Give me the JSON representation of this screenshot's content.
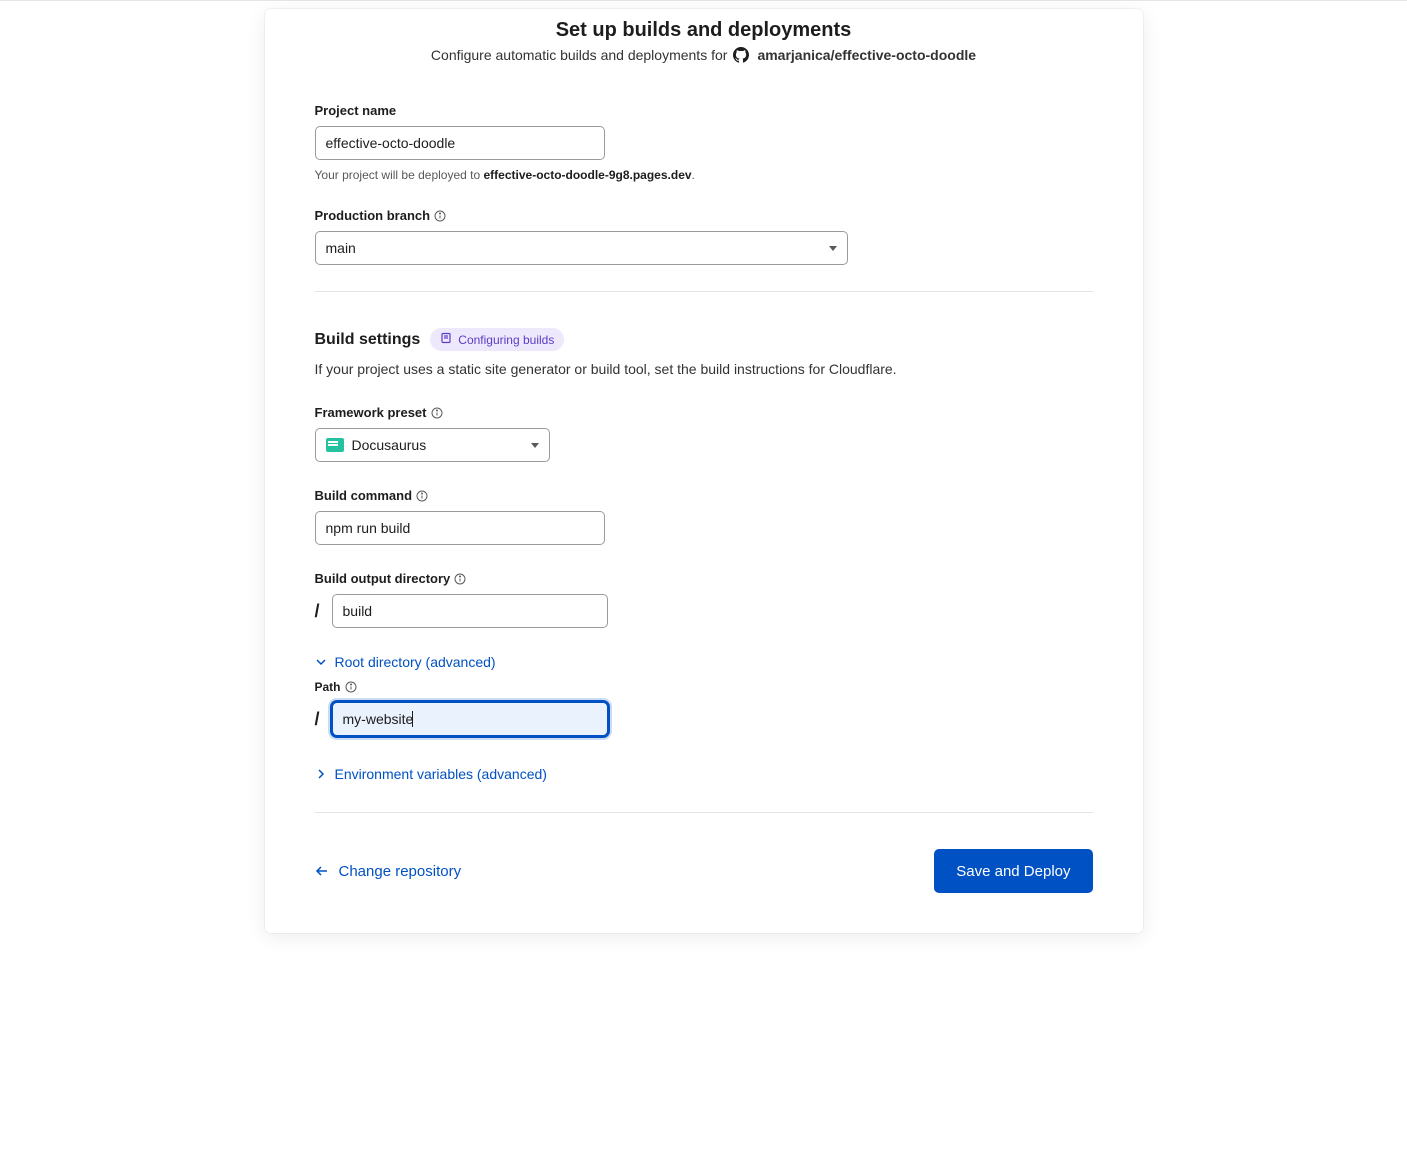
{
  "header": {
    "title": "Set up builds and deployments",
    "subtitle_prefix": "Configure automatic builds and deployments for",
    "repo": "amarjanica/effective-octo-doodle"
  },
  "project_name": {
    "label": "Project name",
    "value": "effective-octo-doodle",
    "helper_prefix": "Your project will be deployed to ",
    "helper_domain": "effective-octo-doodle-9g8.pages.dev"
  },
  "production_branch": {
    "label": "Production branch",
    "value": "main"
  },
  "build_settings": {
    "heading": "Build settings",
    "badge_label": "Configuring builds",
    "description": "If your project uses a static site generator or build tool, set the build instructions for Cloudflare."
  },
  "framework_preset": {
    "label": "Framework preset",
    "value": "Docusaurus"
  },
  "build_command": {
    "label": "Build command",
    "value": "npm run build"
  },
  "build_output_dir": {
    "label": "Build output directory",
    "prefix": "/",
    "value": "build"
  },
  "root_directory": {
    "toggle_label": "Root directory (advanced)",
    "path_label": "Path",
    "prefix": "/",
    "value": "my-website"
  },
  "env_vars": {
    "toggle_label": "Environment variables (advanced)"
  },
  "footer": {
    "back_label": "Change repository",
    "submit_label": "Save and Deploy"
  }
}
